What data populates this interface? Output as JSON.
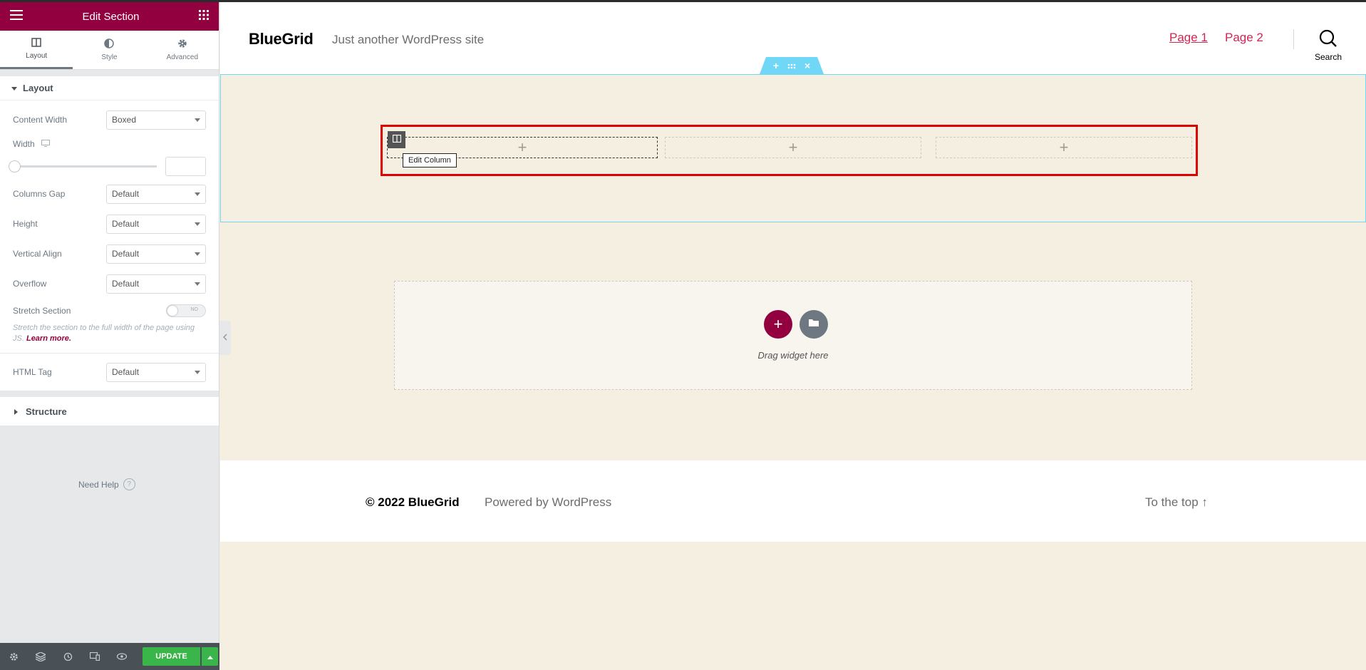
{
  "panel": {
    "title": "Edit Section",
    "tabs": [
      {
        "label": "Layout",
        "icon": "layout-icon"
      },
      {
        "label": "Style",
        "icon": "contrast-icon"
      },
      {
        "label": "Advanced",
        "icon": "gear-icon"
      }
    ],
    "layout_section": {
      "title": "Layout",
      "content_width": {
        "label": "Content Width",
        "value": "Boxed"
      },
      "width": {
        "label": "Width",
        "value": ""
      },
      "columns_gap": {
        "label": "Columns Gap",
        "value": "Default"
      },
      "height": {
        "label": "Height",
        "value": "Default"
      },
      "vertical_align": {
        "label": "Vertical Align",
        "value": "Default"
      },
      "overflow": {
        "label": "Overflow",
        "value": "Default"
      },
      "stretch": {
        "label": "Stretch Section",
        "toggle_text": "NO",
        "desc": "Stretch the section to the full width of the page using JS.",
        "link": "Learn more."
      },
      "html_tag": {
        "label": "HTML Tag",
        "value": "Default"
      }
    },
    "structure_title": "Structure",
    "need_help": "Need Help",
    "update_label": "UPDATE"
  },
  "site": {
    "logo": "BlueGrid",
    "tagline": "Just another WordPress site",
    "nav": [
      "Page 1",
      "Page 2"
    ],
    "search_label": "Search",
    "column_tooltip": "Edit Column",
    "drop_text": "Drag widget here",
    "footer": {
      "copyright": "© 2022 BlueGrid",
      "powered": "Powered by WordPress",
      "to_top": "To the top ↑"
    }
  },
  "colors": {
    "brand": "#93003f",
    "accent_link": "#cd2653",
    "handle": "#71d7f7",
    "selection": "#e00000",
    "update": "#39b54a"
  }
}
